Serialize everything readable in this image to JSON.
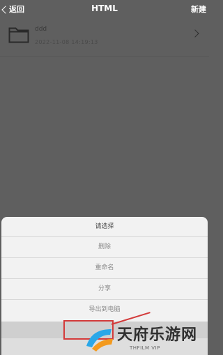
{
  "navbar": {
    "back_label": "返回",
    "title": "HTML",
    "new_label": "新建"
  },
  "file": {
    "name": "ddd",
    "modified": "2022-11-08 14:19:13"
  },
  "action_sheet": {
    "header": "请选择",
    "items": [
      {
        "label": "删除"
      },
      {
        "label": "重命名"
      },
      {
        "label": "分享"
      },
      {
        "label": "导出到电脑"
      }
    ]
  },
  "watermark": {
    "title": "天府乐游网",
    "subtitle": "THFILM VIP"
  },
  "colors": {
    "overlay": "#5f5f5f",
    "sheet": "#f2f2f2",
    "highlight": "#d33a3a",
    "logo_blue": "#2aa7e8",
    "logo_orange": "#f39a1e"
  }
}
